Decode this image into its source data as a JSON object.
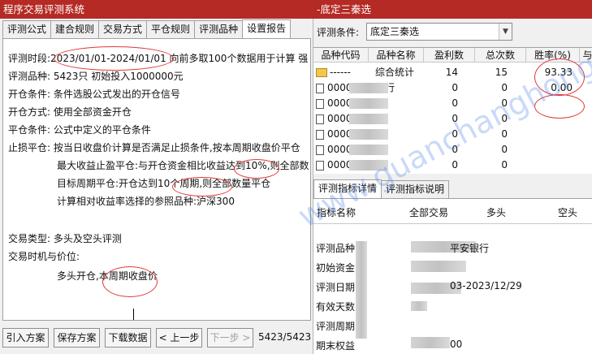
{
  "left_window": {
    "title": "程序交易评测系统",
    "tabs": [
      "评测公式",
      "建合规则",
      "交易方式",
      "平仓规则",
      "评测品种",
      "设置报告"
    ],
    "active_tab": "设置报告",
    "report": {
      "period_label": "评测时段:",
      "period_value": "2023/01/01-2024/01/01",
      "period_note": " 向前多取100个数据用于计算 强",
      "varieties_label": "评测品种:",
      "varieties_value": "5423只 初始投入1000000元",
      "open_cond_label": "开仓条件:",
      "open_cond_value": "条件选股公式发出的开仓信号",
      "open_mode_label": "开仓方式:",
      "open_mode_value": "使用全部资金开仓",
      "close_cond_label": "平仓条件:",
      "close_cond_value": "公式中定义的平仓条件",
      "stop_label": "止损平仓:",
      "stop_value": "按当日收盘价计算是否满足止损条件,按本周期收盘价平仓",
      "max_profit": "最大收益止盈平仓:与开仓资金相比收益达到10%,则全部数",
      "target_period": "目标周期平仓:开仓达到10个周期,则全部数量平仓",
      "benchmark": "计算相对收益率选择的参照品种:沪深300",
      "trade_type_label": "交易类型:",
      "trade_type_value": "多头及空头评测",
      "trade_timing_label": "交易时机与价位:",
      "trade_timing_value": "多头开仓,本周期收盘价"
    },
    "buttons": {
      "import": "引入方案",
      "save": "保存方案",
      "download": "下载数据",
      "prev": "< 上一步",
      "next": "下一步 >"
    },
    "progress": "5423/5423"
  },
  "right_window": {
    "title": "-底定三秦选",
    "condition_label": "评测条件:",
    "condition_value": "底定三秦选",
    "grid_headers": [
      "品种代码",
      "品种名称",
      "盈利数",
      "总次数",
      "胜率(%)",
      "与"
    ],
    "summary_row": {
      "code": "------",
      "name": "综合统计",
      "profit": "14",
      "total": "15",
      "winrate": "93.33"
    },
    "rows": [
      {
        "code": "0000",
        "name": "银行",
        "profit": "0",
        "total": "0",
        "winrate": "0.00"
      },
      {
        "code": "0000",
        "name": "A",
        "profit": "0",
        "total": "0",
        "winrate": ""
      },
      {
        "code": "0000",
        "name": "华",
        "profit": "0",
        "total": "0",
        "winrate": ""
      },
      {
        "code": "0000",
        "name": "A",
        "profit": "0",
        "total": "0",
        "winrate": ""
      },
      {
        "code": "0000",
        "name": "子",
        "profit": "0",
        "total": "0",
        "winrate": ""
      },
      {
        "code": "0000",
        "name": "铁",
        "profit": "0",
        "total": "0",
        "winrate": ""
      },
      {
        "code": "0000",
        "name": "",
        "profit": "",
        "total": "",
        "winrate": ""
      }
    ],
    "tabs": [
      "评测指标详情",
      "评测指标说明"
    ],
    "detail_headers": [
      "指标名称",
      "全部交易",
      "多头",
      "空头"
    ],
    "detail_rows": [
      {
        "label": "评测品种",
        "value": "平安银行"
      },
      {
        "label": "初始资金",
        "value": ""
      },
      {
        "label": "评测日期",
        "value": "03-2023/12/29"
      },
      {
        "label": "有效天数",
        "value": ""
      },
      {
        "label": "评测周期",
        "value": ""
      },
      {
        "label": "期末权益",
        "value": "00"
      }
    ],
    "annotation_color": "#e23838"
  },
  "watermark": "www.guanchanghong.com"
}
